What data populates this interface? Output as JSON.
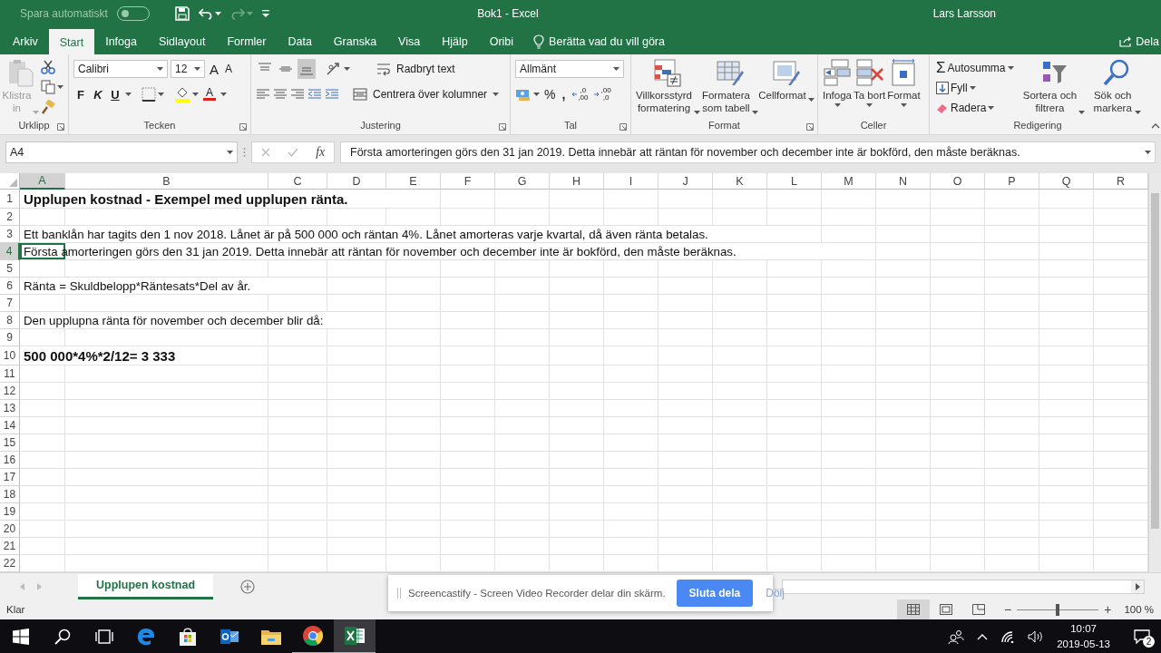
{
  "title_bar": {
    "autosave_label": "Spara automatiskt",
    "autosave_on": false,
    "document_title": "Bok1 - Excel",
    "user": "Lars Larsson"
  },
  "menu_tabs": [
    {
      "label": "Arkiv",
      "selected": false
    },
    {
      "label": "Start",
      "selected": true
    },
    {
      "label": "Infoga",
      "selected": false
    },
    {
      "label": "Sidlayout",
      "selected": false
    },
    {
      "label": "Formler",
      "selected": false
    },
    {
      "label": "Data",
      "selected": false
    },
    {
      "label": "Granska",
      "selected": false
    },
    {
      "label": "Visa",
      "selected": false
    },
    {
      "label": "Hjälp",
      "selected": false
    },
    {
      "label": "Oribi",
      "selected": false
    }
  ],
  "tell_me": "Berätta vad du vill göra",
  "share": "Dela",
  "clipboard": {
    "paste": "Klistra in",
    "group": "Urklipp"
  },
  "font": {
    "name": "Calibri",
    "size": "12",
    "grow": "A",
    "shrink": "A",
    "bold": "F",
    "italic": "K",
    "underline": "U",
    "color_letter": "A",
    "group": "Tecken"
  },
  "alignment": {
    "vertical": [
      {
        "selected": false
      },
      {
        "selected": false
      },
      {
        "selected": true
      }
    ],
    "wrap": "Radbryt text",
    "merge": "Centrera över kolumner",
    "group": "Justering"
  },
  "number": {
    "format": "Allmänt",
    "percent": "%",
    "comma": ",",
    "decimals": [
      {
        "top": ",0",
        "bottom": ",00"
      },
      {
        "top": ",00",
        "bottom": ",0"
      }
    ],
    "group": "Tal"
  },
  "styles": {
    "items": [
      {
        "kind": "conditional",
        "label": "Villkorsstyrd formatering"
      },
      {
        "kind": "table",
        "label": "Formatera som tabell"
      },
      {
        "kind": "cell",
        "label": "Cellformat"
      }
    ],
    "group": "Format"
  },
  "cells": {
    "items": [
      {
        "kind": "insert",
        "label": "Infoga"
      },
      {
        "kind": "delete",
        "label": "Ta bort"
      },
      {
        "kind": "format",
        "label": "Format"
      }
    ],
    "group": "Celler"
  },
  "editing": {
    "autosum_symbol": "Σ",
    "autosum": "Autosumma",
    "fill": "Fyll",
    "clear": "Radera",
    "sort": "Sortera och filtrera",
    "find": "Sök och markera",
    "group": "Redigering"
  },
  "formula_bar": {
    "name_box": "A4",
    "function_label": "fx",
    "formula": "Första amorteringen görs den 31 jan 2019. Detta innebär att räntan för november och december inte är bokförd, den måste beräknas."
  },
  "columns": [
    {
      "label": "A",
      "selected": true
    },
    {
      "label": "B",
      "selected": false
    },
    {
      "label": "C",
      "selected": false
    },
    {
      "label": "D",
      "selected": false
    },
    {
      "label": "E",
      "selected": false
    },
    {
      "label": "F",
      "selected": false
    },
    {
      "label": "G",
      "selected": false
    },
    {
      "label": "H",
      "selected": false
    },
    {
      "label": "I",
      "selected": false
    },
    {
      "label": "J",
      "selected": false
    },
    {
      "label": "K",
      "selected": false
    },
    {
      "label": "L",
      "selected": false
    },
    {
      "label": "M",
      "selected": false
    },
    {
      "label": "N",
      "selected": false
    },
    {
      "label": "O",
      "selected": false
    },
    {
      "label": "P",
      "selected": false
    },
    {
      "label": "Q",
      "selected": false
    },
    {
      "label": "R",
      "selected": false
    }
  ],
  "rows": [
    {
      "number": "1",
      "selected": false,
      "kind": "heading",
      "text": "Upplupen kostnad - Exempel med upplupen ränta."
    },
    {
      "number": "2",
      "selected": false
    },
    {
      "number": "3",
      "selected": false,
      "kind": "text",
      "text": "Ett banklån har tagits den 1 nov 2018. Lånet är på 500 000 och räntan 4%. Lånet amorteras varje kvartal, då även ränta betalas."
    },
    {
      "number": "4",
      "selected": true,
      "kind": "text",
      "text": "Första amorteringen görs den 31 jan 2019. Detta innebär att räntan för november och december inte är bokförd, den måste beräknas."
    },
    {
      "number": "5",
      "selected": false
    },
    {
      "number": "6",
      "selected": false,
      "kind": "text",
      "text": "Ränta = Skuldbelopp*Räntesats*Del av år."
    },
    {
      "number": "7",
      "selected": false
    },
    {
      "number": "8",
      "selected": false,
      "kind": "text",
      "text": "Den upplupna ränta för november och december blir då:"
    },
    {
      "number": "9",
      "selected": false
    },
    {
      "number": "10",
      "selected": false,
      "kind": "heading",
      "text": "500 000*4%*2/12= 3 333"
    },
    {
      "number": "11",
      "selected": false
    },
    {
      "number": "12",
      "selected": false
    },
    {
      "number": "13",
      "selected": false
    },
    {
      "number": "14",
      "selected": false
    },
    {
      "number": "15",
      "selected": false
    },
    {
      "number": "16",
      "selected": false
    },
    {
      "number": "17",
      "selected": false
    },
    {
      "number": "18",
      "selected": false
    },
    {
      "number": "19",
      "selected": false
    },
    {
      "number": "20",
      "selected": false
    },
    {
      "number": "21",
      "selected": false
    },
    {
      "number": "22",
      "selected": false
    }
  ],
  "sheet_tabs": [
    {
      "label": "Upplupen kostnad",
      "selected": true
    }
  ],
  "share_notice": {
    "message": "Screencastify - Screen Video Recorder delar din skärm.",
    "stop": "Sluta dela",
    "hide": "Dölj"
  },
  "status_bar": {
    "status": "Klar",
    "views": [
      {
        "kind": "normal",
        "selected": true
      },
      {
        "kind": "layout",
        "selected": false
      },
      {
        "kind": "break",
        "selected": false
      }
    ],
    "zoom_out": "−",
    "zoom_in": "+",
    "zoom": {
      "level": 0.5
    },
    "zoom_label": "100 %"
  },
  "taskbar": {
    "apps": [
      {
        "kind": "start",
        "running": false,
        "selected": false
      },
      {
        "kind": "search",
        "running": false,
        "selected": false
      },
      {
        "kind": "taskview",
        "running": false,
        "selected": false
      },
      {
        "kind": "edge",
        "running": false,
        "selected": false
      },
      {
        "kind": "store",
        "running": false,
        "selected": false
      },
      {
        "kind": "outlook",
        "running": false,
        "selected": false
      },
      {
        "kind": "explorer",
        "running": false,
        "selected": false
      },
      {
        "kind": "chrome",
        "running": true,
        "selected": false
      },
      {
        "kind": "excel",
        "running": true,
        "selected": true
      }
    ],
    "time": "10:07",
    "date": "2019-05-13",
    "notifications": "2"
  }
}
